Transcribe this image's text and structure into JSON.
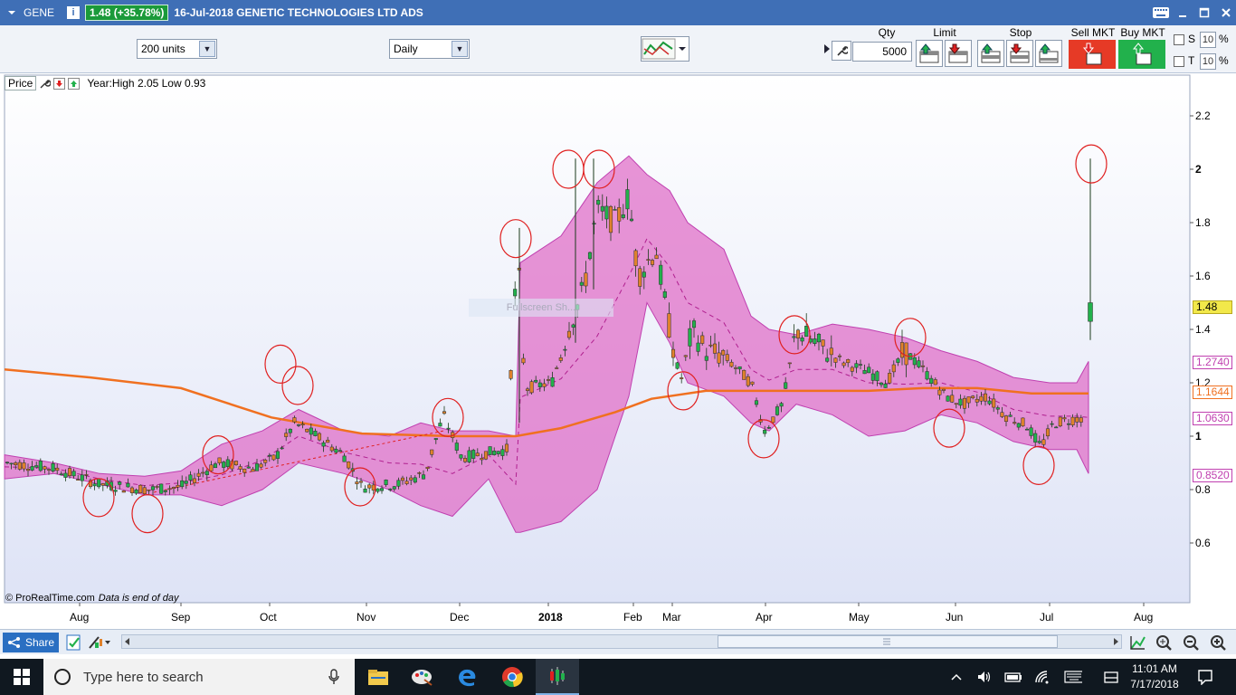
{
  "title_bar": {
    "symbol": "GENE",
    "info_badge": "i",
    "price_badge": "1.48 (+35.78%)",
    "description": "16-Jul-2018 GENETIC TECHNOLOGIES LTD ADS"
  },
  "toolbar": {
    "units_value": "200 units",
    "period_value": "Daily",
    "qty_label": "Qty",
    "qty_value": "5000",
    "limit_label": "Limit",
    "stop_label": "Stop",
    "sell_label": "Sell MKT",
    "buy_label": "Buy MKT",
    "s_label": "S",
    "t_label": "T",
    "s_pct": "10",
    "t_pct": "10",
    "pct_sign": "%"
  },
  "chart_legend": {
    "price_label": "Price",
    "year_text": "Year:High 2.05 Low 0.93"
  },
  "fullscreen_hint": "Fullscreen Sh...",
  "copyright": "© ProRealTime.com",
  "data_note": "Data is end of day",
  "colors": {
    "accent": "#3f6fb6",
    "bull": "#22b14c",
    "bear": "#e0822c",
    "band": "#e070c8",
    "ma": "#f07020",
    "circle": "#e02020"
  },
  "chart_data": {
    "type": "candlestick",
    "y_ticks": [
      "2.2",
      "2",
      "1.8",
      "1.6",
      "1.4",
      "1.2",
      "1",
      "0.8",
      "0.6"
    ],
    "y_bold_ticks": [
      "2",
      "1"
    ],
    "ylim": [
      0.5,
      2.32
    ],
    "x_ticks": [
      "Aug",
      "Sep",
      "Oct",
      "Nov",
      "Dec",
      "2018",
      "Feb",
      "Mar",
      "Apr",
      "May",
      "Jun",
      "Jul",
      "Aug"
    ],
    "last_price": "1.48",
    "tags": [
      {
        "value": "1.2740",
        "color": "#c040b0"
      },
      {
        "value": "1.1644",
        "color": "#f07020"
      },
      {
        "value": "1.0630",
        "color": "#c040b0"
      },
      {
        "value": "0.8520",
        "color": "#c040b0"
      }
    ]
  },
  "bottom_bar": {
    "share_label": "Share"
  },
  "taskbar": {
    "search_placeholder": "Type here to search",
    "time": "11:01 AM",
    "date": "7/17/2018"
  }
}
